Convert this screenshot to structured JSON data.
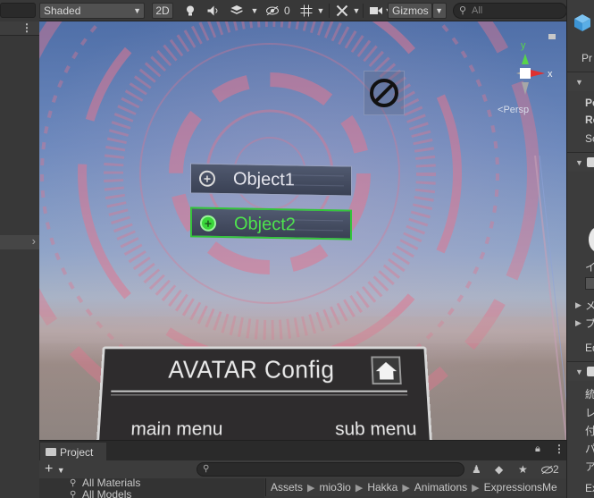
{
  "scene_toolbar": {
    "shading_mode": "Shaded",
    "mode_2d": "2D",
    "hidden_count": "0",
    "gizmos_label": "Gizmos",
    "search_placeholder": "All"
  },
  "scene": {
    "persp_label": "Persp",
    "gizmo_axes": {
      "y": "y",
      "x": "x"
    },
    "buttons": [
      {
        "label": "Object1",
        "selected": false
      },
      {
        "label": "Object2",
        "selected": true
      }
    ],
    "config_panel": {
      "title": "AVATAR Config",
      "main_menu": "main menu",
      "sub_menu": "sub menu"
    },
    "colors": {
      "hud_ring": "#e0768f",
      "selected_green": "#33c43a",
      "sky_top": "#4f6fa8"
    }
  },
  "inspector": {
    "texts": [
      "Pr",
      "Po",
      "Ro",
      "Sc",
      "イ",
      "メ",
      "ブ",
      "Ed",
      "統",
      "レ",
      "付",
      "パ",
      "ア",
      "Ex"
    ]
  },
  "project": {
    "tab_label": "Project",
    "hidden_count": "2",
    "tree": [
      "All Materials",
      "All Models"
    ],
    "breadcrumb": [
      "Assets",
      "mio3io",
      "Hakka",
      "Animations",
      "ExpressionsMe"
    ]
  }
}
